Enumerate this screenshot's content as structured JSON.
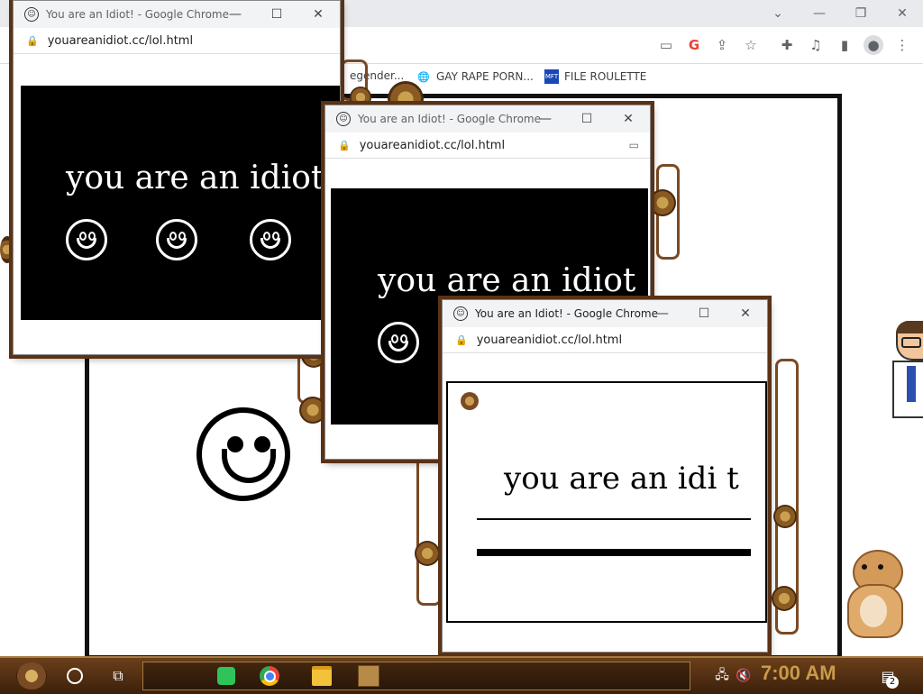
{
  "background_browser": {
    "address_icons": [
      "cast-blocked-icon",
      "google-icon",
      "share-icon",
      "star-icon",
      "extensions-icon",
      "media-icon",
      "sidepanel-icon",
      "profile-icon",
      "menu-icon"
    ],
    "bookmarks": [
      {
        "label": "egender...",
        "icon": "folder-icon"
      },
      {
        "label": "GAY RAPE PORN...",
        "icon": "globe-icon"
      },
      {
        "label": "FILE ROULETTE",
        "icon": "mft-icon"
      }
    ]
  },
  "popups": [
    {
      "title": "You are an Idiot! - Google Chrome",
      "url": "youareanidiot.cc/lol.html",
      "text": "you are an idiot"
    },
    {
      "title": "You are an Idiot! - Google Chrome",
      "url": "youareanidiot.cc/lol.html",
      "text": "you are an idiot"
    },
    {
      "title": "You are an Idiot! - Google Chrome",
      "url": "youareanidiot.cc/lol.html",
      "text": "you are an idi  t"
    }
  ],
  "taskbar": {
    "clock": "7:00 AM",
    "notifications": "2"
  },
  "colors": {
    "steampunk_brown": "#5a3216",
    "taskbar_brass": "#c99a4a",
    "chrome_grey": "#e8eaed"
  }
}
